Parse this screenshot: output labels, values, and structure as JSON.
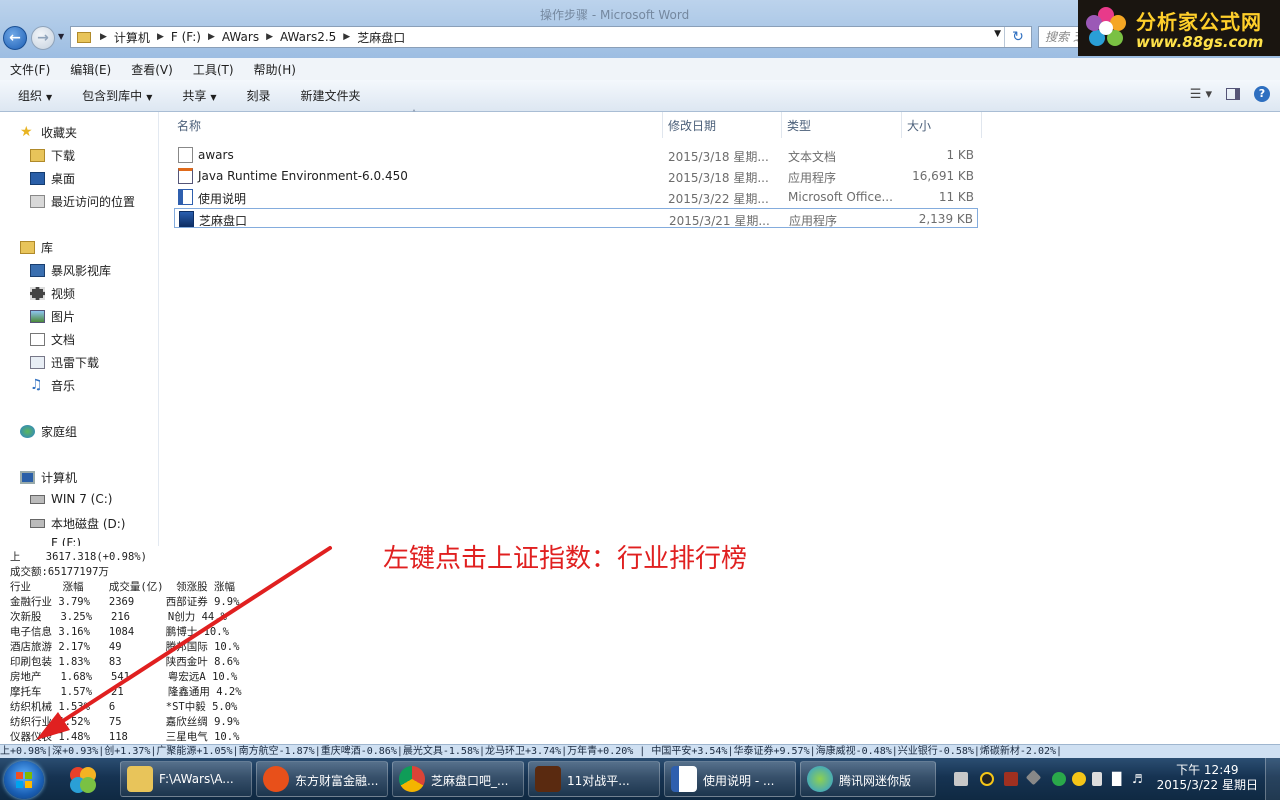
{
  "window": {
    "title_faded": "操作步骤 - Microsoft Word"
  },
  "address": {
    "crumbs": [
      "计算机",
      "F (F:)",
      "AWars",
      "AWars2.5",
      "芝麻盘口"
    ],
    "search_placeholder": "搜索 芝"
  },
  "logo": {
    "title": "分析家公式网",
    "url": "www.88gs.com"
  },
  "menu": [
    "文件(F)",
    "编辑(E)",
    "查看(V)",
    "工具(T)",
    "帮助(H)"
  ],
  "toolbar": {
    "organize": "组织",
    "include_library": "包含到库中",
    "share": "共享",
    "burn": "刻录",
    "new_folder": "新建文件夹"
  },
  "nav": {
    "favorites": "收藏夹",
    "downloads": "下载",
    "desktop": "桌面",
    "recent": "最近访问的位置",
    "libraries": "库",
    "baofeng": "暴风影视库",
    "videos": "视频",
    "pictures": "图片",
    "documents": "文档",
    "xunlei": "迅雷下载",
    "music": "音乐",
    "homegroup": "家庭组",
    "computer": "计算机",
    "drive_c": "WIN 7 (C:)",
    "drive_d": "本地磁盘 (D:)",
    "drive_f": "F (F:)"
  },
  "columns": {
    "name": "名称",
    "date": "修改日期",
    "type": "类型",
    "size": "大小"
  },
  "files": [
    {
      "name": "awars",
      "date": "2015/3/18 星期...",
      "type": "文本文档",
      "size": "1 KB"
    },
    {
      "name": "Java Runtime Environment-6.0.450",
      "date": "2015/3/18 星期...",
      "type": "应用程序",
      "size": "16,691 KB"
    },
    {
      "name": "使用说明",
      "date": "2015/3/22 星期...",
      "type": "Microsoft Office...",
      "size": "11 KB"
    },
    {
      "name": "芝麻盘口",
      "date": "2015/3/21 星期...",
      "type": "应用程序",
      "size": "2,139 KB"
    }
  ],
  "panel": {
    "index_line": "上    3617.318(+0.98%)",
    "volume_line": "成交额:65177197万",
    "header": "行业     涨幅    成交量(亿)  领涨股 涨幅",
    "rows": [
      "金融行业 3.79%   2369     西部证券 9.9%",
      "次新股   3.25%   216      N创力 44.%",
      "电子信息 3.16%   1084     鹏博士 10.%",
      "酒店旅游 2.17%   49       腾邦国际 10.%",
      "印刷包装 1.83%   83       陕西金叶 8.6%",
      "房地产   1.68%   541      粤宏远A 10.%",
      "摩托车   1.57%   21       隆鑫通用 4.2%",
      "纺织机械 1.53%   6        *ST中毅 5.0%",
      "纺织行业 1.52%   75       嘉欣丝绸 9.9%",
      "仪器仪表 1.48%   118      三星电气 10.%"
    ]
  },
  "annotation": "左键点击上证指数：行业排行榜",
  "ticker": "上+0.98%|深+0.93%|创+1.37%|广聚能源+1.05%|南方航空-1.87%|重庆啤酒-0.86%|晨光文具-1.58%|龙马环卫+3.74%|万年青+0.20%  | 中国平安+3.54%|华泰证券+9.57%|海康威视-0.48%|兴业银行-0.58%|烯碳新材-2.02%|",
  "taskbar": {
    "items": [
      {
        "label": "F:\\AWars\\A...",
        "icon": "folder-icon",
        "color": "#e8c45a"
      },
      {
        "label": "东方财富金融...",
        "icon": "eastmoney-icon",
        "color": "#e8501a"
      },
      {
        "label": "芝麻盘口吧_...",
        "icon": "chrome-icon",
        "color": "#3b8fe0"
      },
      {
        "label": "11对战平...",
        "icon": "game-icon",
        "color": "#5a2a10"
      },
      {
        "label": "使用说明 - ...",
        "icon": "word-icon",
        "color": "#2f5fae"
      },
      {
        "label": "腾讯网迷你版",
        "icon": "tencent-icon",
        "color": "#2b9be0"
      }
    ],
    "clock_time": "下午 12:49",
    "clock_date": "2015/3/22 星期日"
  },
  "colors": {
    "accent": "#2e6fc0",
    "annotation": "#e02020",
    "logo_text": "#ffcf2a"
  }
}
